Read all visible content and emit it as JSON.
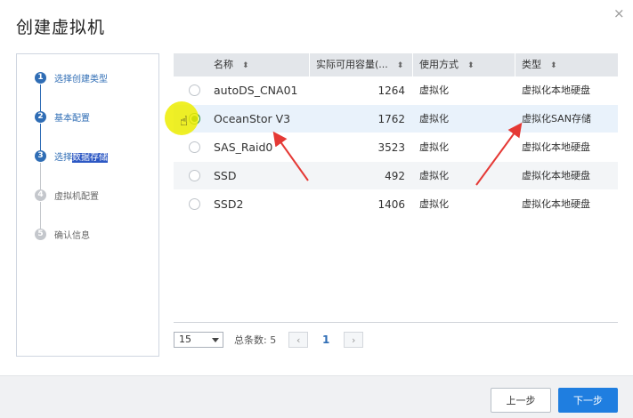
{
  "dialog": {
    "title": "创建虚拟机",
    "close_icon": "close-icon",
    "close_glyph": "×"
  },
  "steps": [
    {
      "number": "1",
      "label": "选择创建类型",
      "state": "done"
    },
    {
      "number": "2",
      "label": "基本配置",
      "state": "done"
    },
    {
      "number": "3",
      "label_prefix": "选择",
      "label_highlight": "数据存储",
      "state": "current"
    },
    {
      "number": "4",
      "label": "虚拟机配置",
      "state": "pending"
    },
    {
      "number": "5",
      "label": "确认信息",
      "state": "pending"
    }
  ],
  "table": {
    "columns": [
      "名称",
      "实际可用容量(...",
      "使用方式",
      "类型"
    ],
    "sort_glyph": "⬍",
    "rows": [
      {
        "name": "autoDS_CNA01",
        "capacity": "1264",
        "usage": "虚拟化",
        "type": "虚拟化本地硬盘",
        "selected": false
      },
      {
        "name": "OceanStor V3",
        "capacity": "1762",
        "usage": "虚拟化",
        "type": "虚拟化SAN存储",
        "selected": true
      },
      {
        "name": "SAS_Raid0",
        "capacity": "3523",
        "usage": "虚拟化",
        "type": "虚拟化本地硬盘",
        "selected": false
      },
      {
        "name": "SSD",
        "capacity": "492",
        "usage": "虚拟化",
        "type": "虚拟化本地硬盘",
        "selected": false
      },
      {
        "name": "SSD2",
        "capacity": "1406",
        "usage": "虚拟化",
        "type": "虚拟化本地硬盘",
        "selected": false
      }
    ]
  },
  "pager": {
    "page_size": "15",
    "total": "总条数: 5",
    "prev_glyph": "‹",
    "next_glyph": "›",
    "current_page": "1"
  },
  "footer": {
    "prev_label": "上一步",
    "next_label": "下一步"
  },
  "colors": {
    "accent": "#2f6db5",
    "primary_button": "#1f7ee0",
    "annotation_arrow": "#e53935",
    "cursor_highlight": "#eded00"
  }
}
